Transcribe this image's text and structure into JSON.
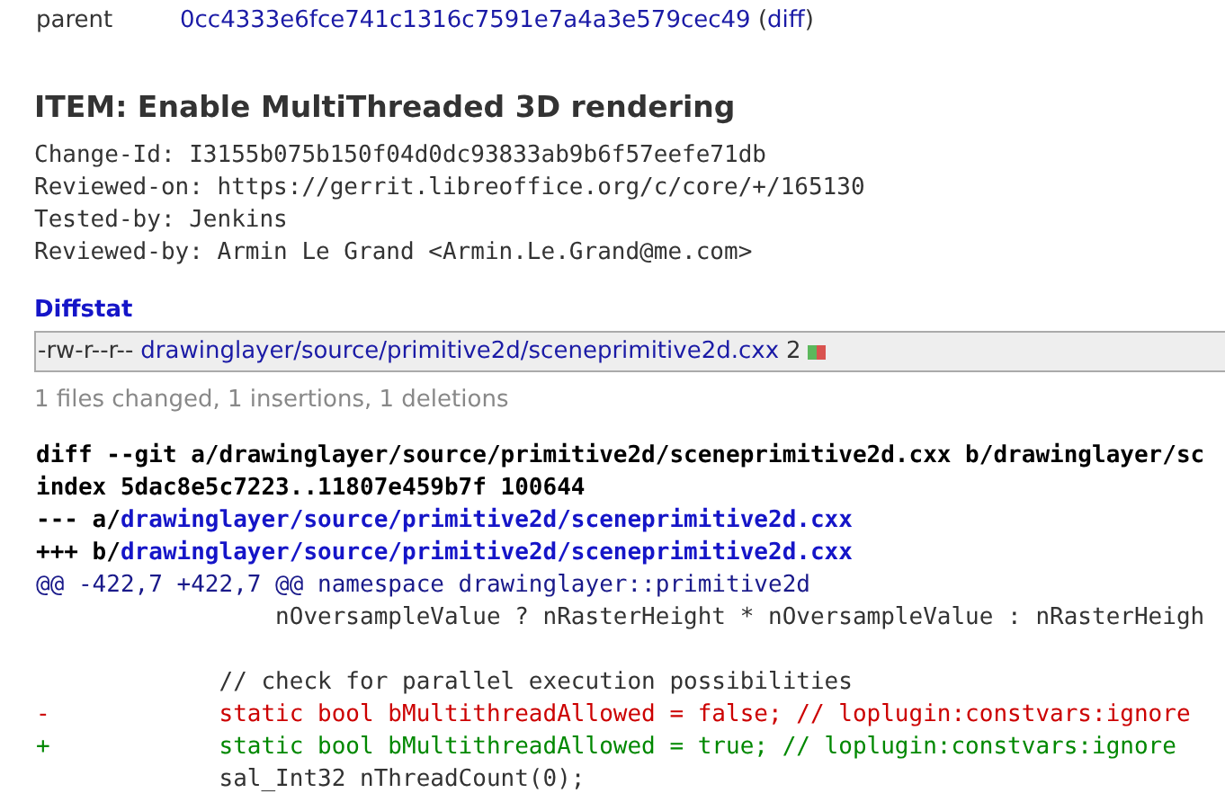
{
  "commit_info": {
    "label": "parent",
    "hash": "0cc4333e6fce741c1316c7591e7a4a3e579cec49",
    "open_paren": "(",
    "diff_link": "diff",
    "close_paren": ")"
  },
  "title": "ITEM: Enable MultiThreaded 3D rendering",
  "message_lines": [
    "Change-Id: I3155b075b150f04d0dc93833ab9b6f57eefe71db",
    "Reviewed-on: https://gerrit.libreoffice.org/c/core/+/165130",
    "Tested-by: Jenkins",
    "Reviewed-by: Armin Le Grand <Armin.Le.Grand@me.com>"
  ],
  "diffstat": {
    "heading": "Diffstat",
    "files": [
      {
        "mode": "-rw-r--r--",
        "path": "drawinglayer/source/primitive2d/sceneprimitive2d.cxx",
        "count": "2"
      }
    ],
    "summary": "1 files changed, 1 insertions, 1 deletions"
  },
  "diff_lines": [
    {
      "kind": "header",
      "text": "diff --git a/drawinglayer/source/primitive2d/sceneprimitive2d.cxx b/drawinglayer/sc"
    },
    {
      "kind": "header",
      "text": "index 5dac8e5c7223..11807e459b7f 100644"
    },
    {
      "kind": "file",
      "prefix": "--- a/",
      "path": "drawinglayer/source/primitive2d/sceneprimitive2d.cxx"
    },
    {
      "kind": "file",
      "prefix": "+++ b/",
      "path": "drawinglayer/source/primitive2d/sceneprimitive2d.cxx"
    },
    {
      "kind": "hunk",
      "text": "@@ -422,7 +422,7 @@ namespace drawinglayer::primitive2d"
    },
    {
      "kind": "context",
      "text": "                 nOversampleValue ? nRasterHeight * nOversampleValue : nRasterHeigh"
    },
    {
      "kind": "blank"
    },
    {
      "kind": "context",
      "text": "             // check for parallel execution possibilities"
    },
    {
      "kind": "del",
      "text": "-            static bool bMultithreadAllowed = false; // loplugin:constvars:ignore"
    },
    {
      "kind": "add",
      "text": "+            static bool bMultithreadAllowed = true; // loplugin:constvars:ignore"
    },
    {
      "kind": "context",
      "text": "             sal_Int32 nThreadCount(0);"
    }
  ]
}
